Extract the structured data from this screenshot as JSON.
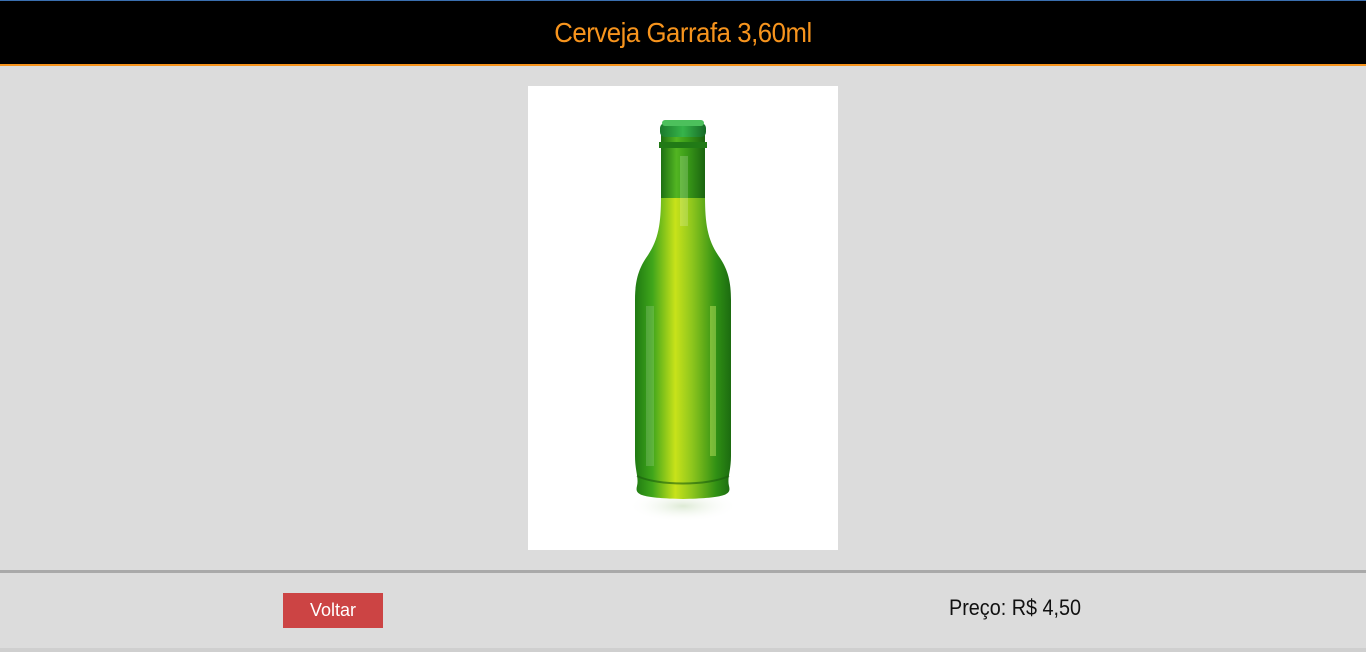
{
  "header": {
    "title": "Cerveja Garrafa 3,60ml"
  },
  "product": {
    "image_icon": "green-beer-bottle-icon"
  },
  "footer": {
    "back_label": "Voltar",
    "price_label": "Preço: R$ 4,50"
  },
  "colors": {
    "header_bg": "#000000",
    "title_color": "#f7941d",
    "accent_line": "#f7941d",
    "button_bg": "#cc4444",
    "page_bg": "#dcdcdc"
  }
}
